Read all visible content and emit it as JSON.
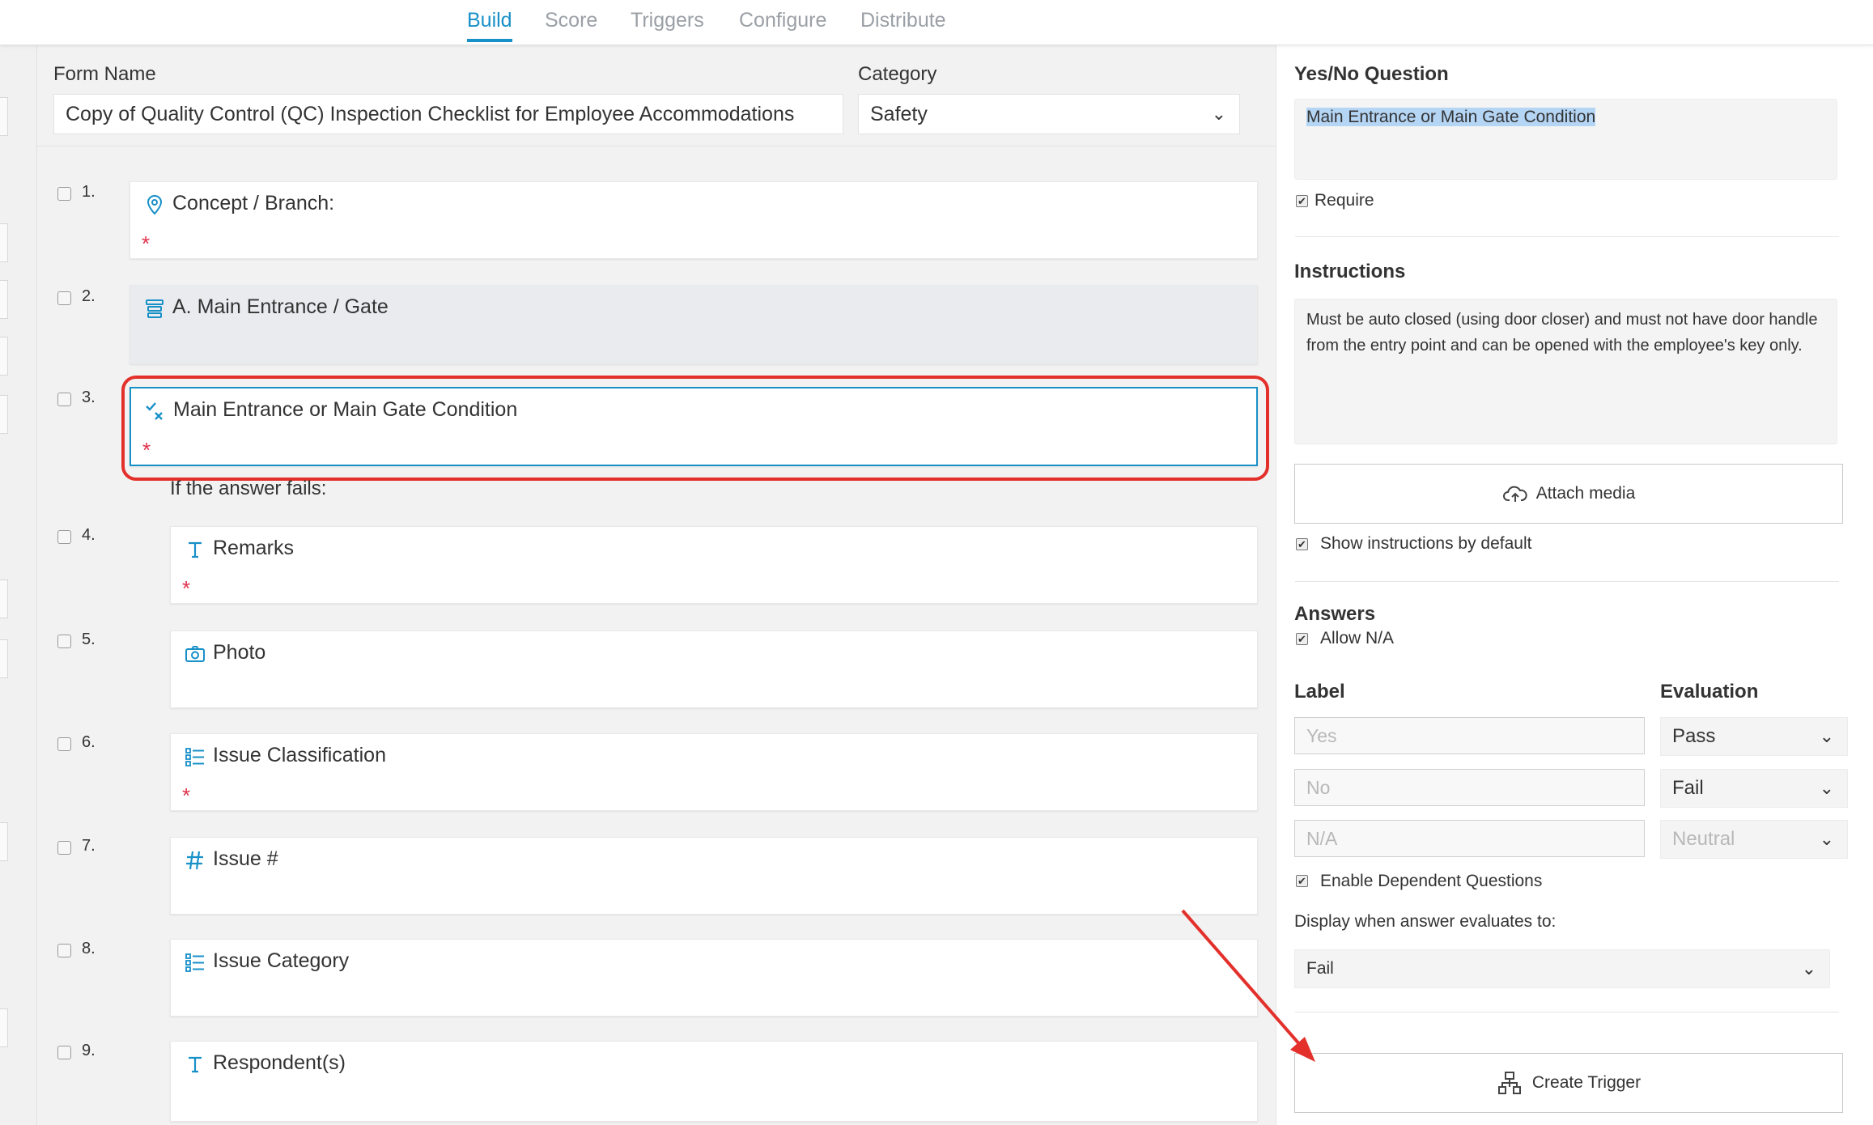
{
  "nav": {
    "tabs": [
      {
        "label": "Build",
        "active": true
      },
      {
        "label": "Score",
        "active": false
      },
      {
        "label": "Triggers",
        "active": false
      },
      {
        "label": "Configure",
        "active": false
      },
      {
        "label": "Distribute",
        "active": false
      }
    ]
  },
  "form": {
    "name_label": "Form Name",
    "name_value": "Copy of Quality Control (QC) Inspection Checklist for Employee Accommodations",
    "category_label": "Category",
    "category_value": "Safety"
  },
  "questions": [
    {
      "num": "1.",
      "title": "Concept / Branch:",
      "icon": "location-pin-icon",
      "required": "*"
    },
    {
      "num": "2.",
      "title": "A. Main Entrance / Gate",
      "icon": "section-icon",
      "required": ""
    },
    {
      "num": "3.",
      "title": "Main Entrance or Main Gate Condition",
      "icon": "yes-no-icon",
      "required": "*"
    },
    {
      "num": "4.",
      "title": "Remarks",
      "icon": "text-icon",
      "required": "*"
    },
    {
      "num": "5.",
      "title": "Photo",
      "icon": "camera-icon",
      "required": ""
    },
    {
      "num": "6.",
      "title": "Issue Classification",
      "icon": "list-icon",
      "required": "*"
    },
    {
      "num": "7.",
      "title": "Issue #",
      "icon": "hash-icon",
      "required": ""
    },
    {
      "num": "8.",
      "title": "Issue Category",
      "icon": "list-icon",
      "required": ""
    },
    {
      "num": "9.",
      "title": "Respondent(s)",
      "icon": "text-icon",
      "required": ""
    }
  ],
  "fails_label": "If the answer fails:",
  "panel": {
    "question_heading": "Yes/No Question",
    "question_text": "Main Entrance or Main Gate Condition",
    "require_label": "Require",
    "instructions_heading": "Instructions",
    "instructions_text": "Must be auto closed (using door closer) and must not have door handle from the entry point and can be opened with the employee's key only.",
    "attach_media": "Attach media",
    "show_instructions": "Show instructions by default",
    "answers_heading": "Answers",
    "allow_na": "Allow N/A",
    "label_heading": "Label",
    "evaluation_heading": "Evaluation",
    "answers": [
      {
        "label_placeholder": "Yes",
        "evaluation": "Pass",
        "disabled": false
      },
      {
        "label_placeholder": "No",
        "evaluation": "Fail",
        "disabled": false
      },
      {
        "label_placeholder": "N/A",
        "evaluation": "Neutral",
        "disabled": true
      }
    ],
    "enable_dependent": "Enable Dependent Questions",
    "display_when": "Display when answer evaluates to:",
    "display_value": "Fail",
    "create_trigger": "Create Trigger",
    "check_mark": "✔"
  },
  "colors": {
    "accent": "#1890c8",
    "highlight": "#e3302b",
    "required": "#e0324b"
  }
}
